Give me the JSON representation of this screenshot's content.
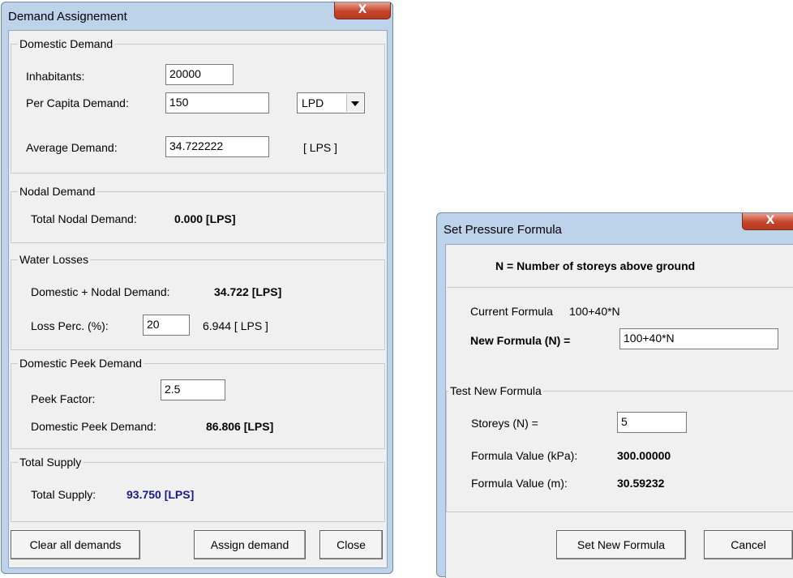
{
  "colors": {
    "frame": "#bcd3ea",
    "close": "#c6442a",
    "blue_text": "#1a1a8c"
  },
  "demand": {
    "title": "Demand Assignement",
    "close_glyph": "X",
    "domestic": {
      "group_label": "Domestic Demand",
      "inhabitants_label": "Inhabitants:",
      "inhabitants_value": "20000",
      "per_capita_label": "Per Capita Demand:",
      "per_capita_value": "150",
      "unit_selected": "LPD",
      "average_label": "Average Demand:",
      "average_value": "34.722222",
      "average_unit": "[ LPS ]"
    },
    "nodal": {
      "group_label": "Nodal Demand",
      "total_label": "Total Nodal Demand:",
      "total_value": "0.000 [LPS]"
    },
    "losses": {
      "group_label": "Water Losses",
      "dom_nodal_label": "Domestic + Nodal Demand:",
      "dom_nodal_value": "34.722 [LPS]",
      "loss_label": "Loss Perc. (%):",
      "loss_value": "20",
      "loss_result": "6.944 [ LPS ]"
    },
    "peek": {
      "group_label": "Domestic Peek Demand",
      "factor_label": "Peek Factor:",
      "factor_value": "2.5",
      "demand_label": "Domestic Peek Demand:",
      "demand_value": "86.806 [LPS]"
    },
    "supply": {
      "group_label": "Total Supply",
      "total_label": "Total Supply:",
      "total_value": "93.750 [LPS]"
    },
    "buttons": {
      "clear": "Clear all demands",
      "assign": "Assign demand",
      "close": "Close"
    }
  },
  "pressure": {
    "title": "Set Pressure Formula",
    "close_glyph": "X",
    "header": "N = Number of storeys above ground",
    "current_label": "Current Formula",
    "current_value": "100+40*N",
    "new_label": "New Formula (N) =",
    "new_value": "100+40*N",
    "test": {
      "group_label": "Test New Formula",
      "storeys_label": "Storeys  (N) =",
      "storeys_value": "5",
      "kpa_label": "Formula Value (kPa):",
      "kpa_value": "300.00000",
      "m_label": "Formula Value (m):",
      "m_value": "30.59232"
    },
    "buttons": {
      "set": "Set New Formula",
      "cancel": "Cancel"
    }
  }
}
